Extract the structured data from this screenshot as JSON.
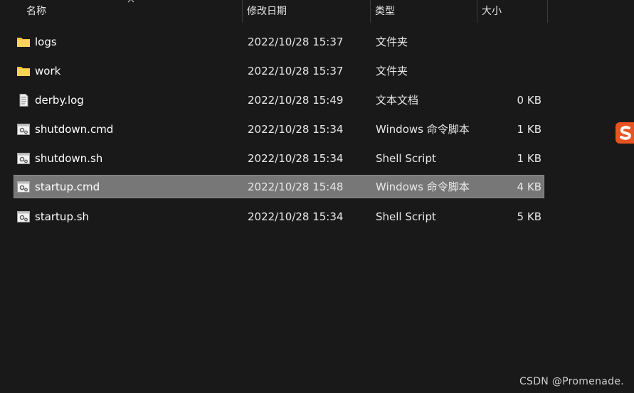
{
  "header": {
    "name_label": "名称",
    "date_label": "修改日期",
    "type_label": "类型",
    "size_label": "大小"
  },
  "files": [
    {
      "name": "logs",
      "modified": "2022/10/28 15:37",
      "type": "文件夹",
      "size": "",
      "icon": "folder-icon"
    },
    {
      "name": "work",
      "modified": "2022/10/28 15:37",
      "type": "文件夹",
      "size": "",
      "icon": "folder-icon"
    },
    {
      "name": "derby.log",
      "modified": "2022/10/28 15:49",
      "type": "文本文档",
      "size": "0 KB",
      "icon": "text-file-icon"
    },
    {
      "name": "shutdown.cmd",
      "modified": "2022/10/28 15:34",
      "type": "Windows 命令脚本",
      "size": "1 KB",
      "icon": "script-file-icon"
    },
    {
      "name": "shutdown.sh",
      "modified": "2022/10/28 15:34",
      "type": "Shell Script",
      "size": "1 KB",
      "icon": "script-file-icon"
    },
    {
      "name": "startup.cmd",
      "modified": "2022/10/28 15:48",
      "type": "Windows 命令脚本",
      "size": "4 KB",
      "icon": "script-file-icon",
      "selected": true
    },
    {
      "name": "startup.sh",
      "modified": "2022/10/28 15:34",
      "type": "Shell Script",
      "size": "5 KB",
      "icon": "script-file-icon"
    }
  ],
  "colors": {
    "background": "#191919",
    "selected_row": "#777777",
    "folder": "#f4c243",
    "badge": "#e8531f"
  },
  "watermark": "CSDN @Promenade."
}
